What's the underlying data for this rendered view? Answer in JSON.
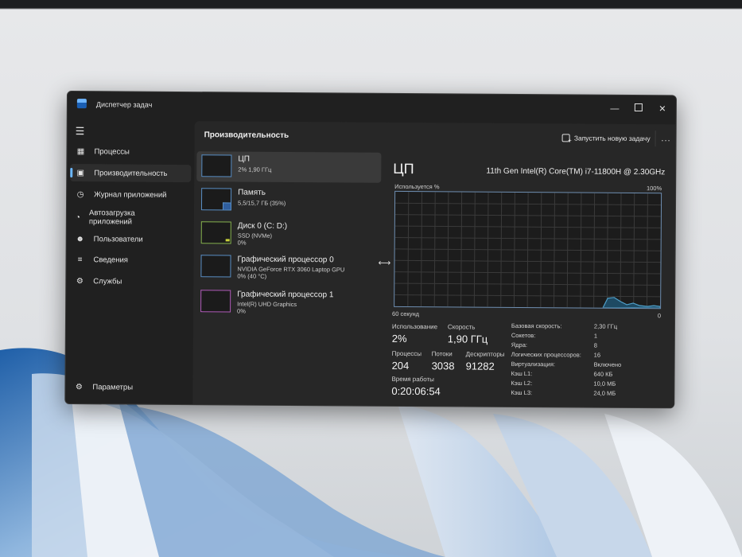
{
  "window": {
    "title": "Диспетчер задач"
  },
  "sidebar": {
    "items": [
      {
        "label": "Процессы",
        "icon": "processes-icon"
      },
      {
        "label": "Производительность",
        "icon": "performance-icon",
        "active": true
      },
      {
        "label": "Журнал приложений",
        "icon": "history-icon"
      },
      {
        "label": "Автозагрузка приложений",
        "icon": "startup-icon"
      },
      {
        "label": "Пользователи",
        "icon": "users-icon"
      },
      {
        "label": "Сведения",
        "icon": "details-icon"
      },
      {
        "label": "Службы",
        "icon": "services-icon"
      }
    ],
    "settings_label": "Параметры"
  },
  "header": {
    "title": "Производительность",
    "new_task_label": "Запустить новую задачу",
    "more_label": "..."
  },
  "devices": [
    {
      "name": "ЦП",
      "line1": "2% 1,90 ГГц",
      "line2": ""
    },
    {
      "name": "Память",
      "line1": "5,5/15,7 ГБ (35%)",
      "line2": ""
    },
    {
      "name": "Диск 0 (C: D:)",
      "line1": "SSD (NVMe)",
      "line2": "0%"
    },
    {
      "name": "Графический процессор 0",
      "line1": "NVIDIA GeForce RTX 3060 Laptop GPU",
      "line2": "0% (40 °C)"
    },
    {
      "name": "Графический процессор 1",
      "line1": "Intel(R) UHD Graphics",
      "line2": "0%"
    }
  ],
  "detail": {
    "title": "ЦП",
    "model": "11th Gen Intel(R) Core(TM) i7-11800H @ 2.30GHz",
    "util_label": "Используется %",
    "max_label": "100%",
    "time_label": "60 секунд",
    "zero_label": "0",
    "stats": {
      "usage_label": "Использование",
      "usage_value": "2%",
      "speed_label": "Скорость",
      "speed_value": "1,90 ГГц",
      "processes_label": "Процессы",
      "processes_value": "204",
      "threads_label": "Потоки",
      "threads_value": "3038",
      "handles_label": "Дескрипторы",
      "handles_value": "91282",
      "uptime_label": "Время работы",
      "uptime_value": "0:20:06:54"
    },
    "specs": [
      {
        "key": "Базовая скорость:",
        "value": "2,30 ГГц"
      },
      {
        "key": "Сокетов:",
        "value": "1"
      },
      {
        "key": "Ядра:",
        "value": "8"
      },
      {
        "key": "Логических процессоров:",
        "value": "16"
      },
      {
        "key": "Виртуализация:",
        "value": "Включено"
      },
      {
        "key": "Кэш L1:",
        "value": "640 КБ"
      },
      {
        "key": "Кэш L2:",
        "value": "10,0 МБ"
      },
      {
        "key": "Кэш L3:",
        "value": "24,0 МБ"
      }
    ]
  },
  "colors": {
    "accent": "#6cb8ff",
    "graph_line": "#4f9fc9",
    "graph_fill": "#1e4a63"
  }
}
